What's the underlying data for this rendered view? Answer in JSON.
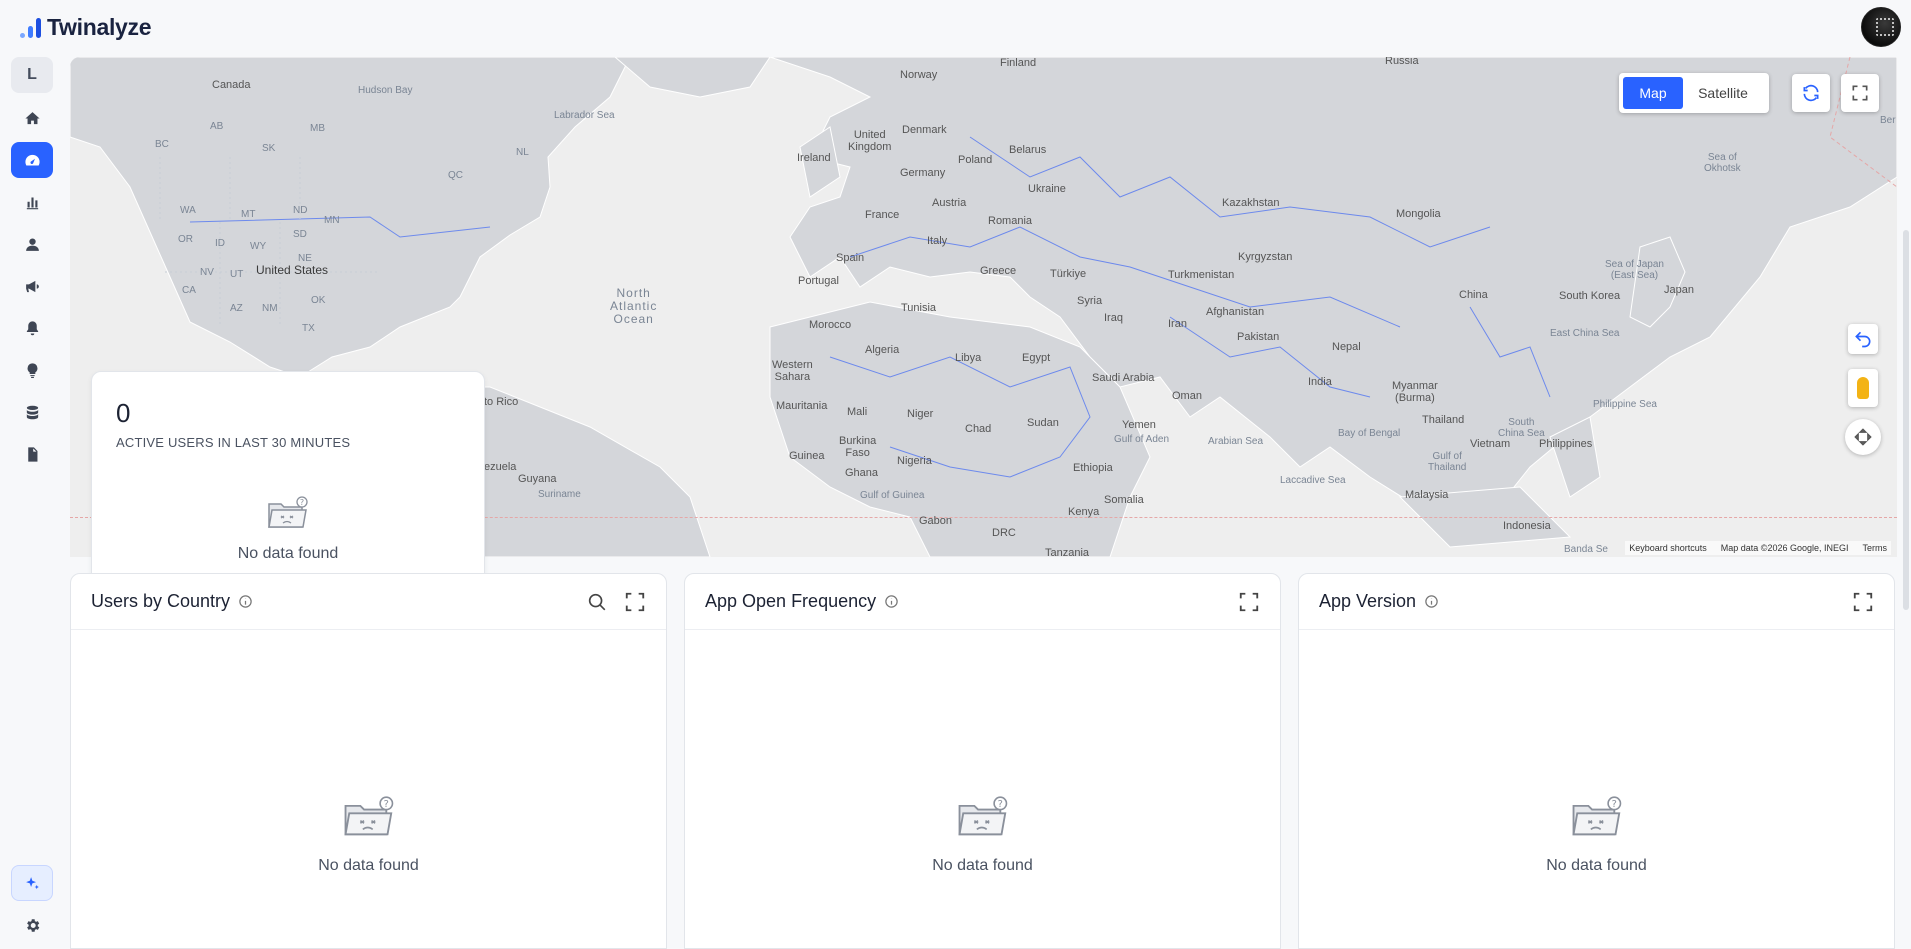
{
  "app": {
    "name": "Twinalyze"
  },
  "sidebar": {
    "workspace_letter": "L",
    "items": [
      {
        "name": "home"
      },
      {
        "name": "dashboard",
        "active": true
      },
      {
        "name": "analytics"
      },
      {
        "name": "users"
      },
      {
        "name": "campaigns"
      },
      {
        "name": "notifications"
      },
      {
        "name": "insights"
      },
      {
        "name": "data"
      },
      {
        "name": "reports"
      }
    ]
  },
  "map": {
    "type_map": "Map",
    "type_satellite": "Satellite",
    "selected_type": "Map",
    "labels": {
      "canada": "Canada",
      "hudson_bay": "Hudson Bay",
      "labrador_sea": "Labrador Sea",
      "bc": "BC",
      "ab": "AB",
      "sk": "SK",
      "mb": "MB",
      "nl": "NL",
      "qc": "QC",
      "wa": "WA",
      "mt": "MT",
      "nd": "ND",
      "mn": "MN",
      "or": "OR",
      "id": "ID",
      "sd": "SD",
      "wy": "WY",
      "nv": "NV",
      "ut": "UT",
      "ne": "NE",
      "ca": "CA",
      "az": "AZ",
      "nm": "NM",
      "tx": "TX",
      "ok": "OK",
      "united_states": "United States",
      "north_atlantic_ocean": "North\nAtlantic\nOcean",
      "puerto_rico": "to Rico",
      "venezuela": "ezuela",
      "guyana": "Guyana",
      "suriname": "Suriname",
      "finland": "Finland",
      "norway": "Norway",
      "russia": "Russia",
      "united_kingdom": "United\nKingdom",
      "denmark": "Denmark",
      "ireland": "Ireland",
      "poland": "Poland",
      "belarus": "Belarus",
      "germany": "Germany",
      "ukraine": "Ukraine",
      "austria": "Austria",
      "france": "France",
      "romania": "Romania",
      "kazakhstan": "Kazakhstan",
      "mongolia": "Mongolia",
      "italy": "Italy",
      "spain": "Spain",
      "portugal": "Portugal",
      "greece": "Greece",
      "turkiye": "Türkiye",
      "kyrgyzstan": "Kyrgyzstan",
      "turkmenistan": "Turkmenistan",
      "sea_of_okhotsk": "Sea of\nOkhotsk",
      "sea_of_japan": "Sea of Japan\n(East Sea)",
      "japan": "Japan",
      "china": "China",
      "south_korea": "South Korea",
      "syria": "Syria",
      "iraq": "Iraq",
      "afghanistan": "Afghanistan",
      "iran": "Iran",
      "tunisia": "Tunisia",
      "morocco": "Morocco",
      "pakistan": "Pakistan",
      "nepal": "Nepal",
      "east_china_sea": "East China Sea",
      "algeria": "Algeria",
      "libya": "Libya",
      "egypt": "Egypt",
      "western_sahara": "Western\nSahara",
      "saudi_arabia": "Saudi Arabia",
      "oman": "Oman",
      "india": "India",
      "myanmar": "Myanmar\n(Burma)",
      "philippine_sea": "Philippine Sea",
      "mauritania": "Mauritania",
      "mali": "Mali",
      "niger": "Niger",
      "chad": "Chad",
      "sudan": "Sudan",
      "yemen": "Yemen",
      "thailand": "Thailand",
      "south_china_sea": "South\nChina Sea",
      "gulf_of_aden": "Gulf of Aden",
      "arabian_sea": "Arabian Sea",
      "bay_of_bengal": "Bay of Bengal",
      "vietnam": "Vietnam",
      "philippines": "Philippines",
      "guinea": "Guinea",
      "burkina_faso": "Burkina\nFaso",
      "nigeria": "Nigeria",
      "ghana": "Ghana",
      "ethiopia": "Ethiopia",
      "gulf_of_thailand": "Gulf of\nThailand",
      "laccadive_sea": "Laccadive Sea",
      "gulf_of_guinea": "Gulf of Guinea",
      "somalia": "Somalia",
      "malaysia": "Malaysia",
      "gabon": "Gabon",
      "kenya": "Kenya",
      "drc": "DRC",
      "indonesia": "Indonesia",
      "tanzania": "Tanzania",
      "banda_sea": "Banda Se",
      "bering": "Ber"
    },
    "attribution": {
      "shortcuts": "Keyboard shortcuts",
      "data": "Map data ©2026 Google, INEGI",
      "terms": "Terms"
    }
  },
  "active_users": {
    "count": "0",
    "label": "ACTIVE USERS IN LAST 30 MINUTES",
    "empty": "No data found"
  },
  "widgets": [
    {
      "title": "Users by Country",
      "empty": "No data found",
      "has_search": true
    },
    {
      "title": "App Open Frequency",
      "empty": "No data found",
      "has_search": false
    },
    {
      "title": "App Version",
      "empty": "No data found",
      "has_search": false
    }
  ],
  "colors": {
    "accent": "#2962ff",
    "land": "#d4d6da",
    "water": "#eeeeee",
    "border": "#5b7cf0"
  }
}
